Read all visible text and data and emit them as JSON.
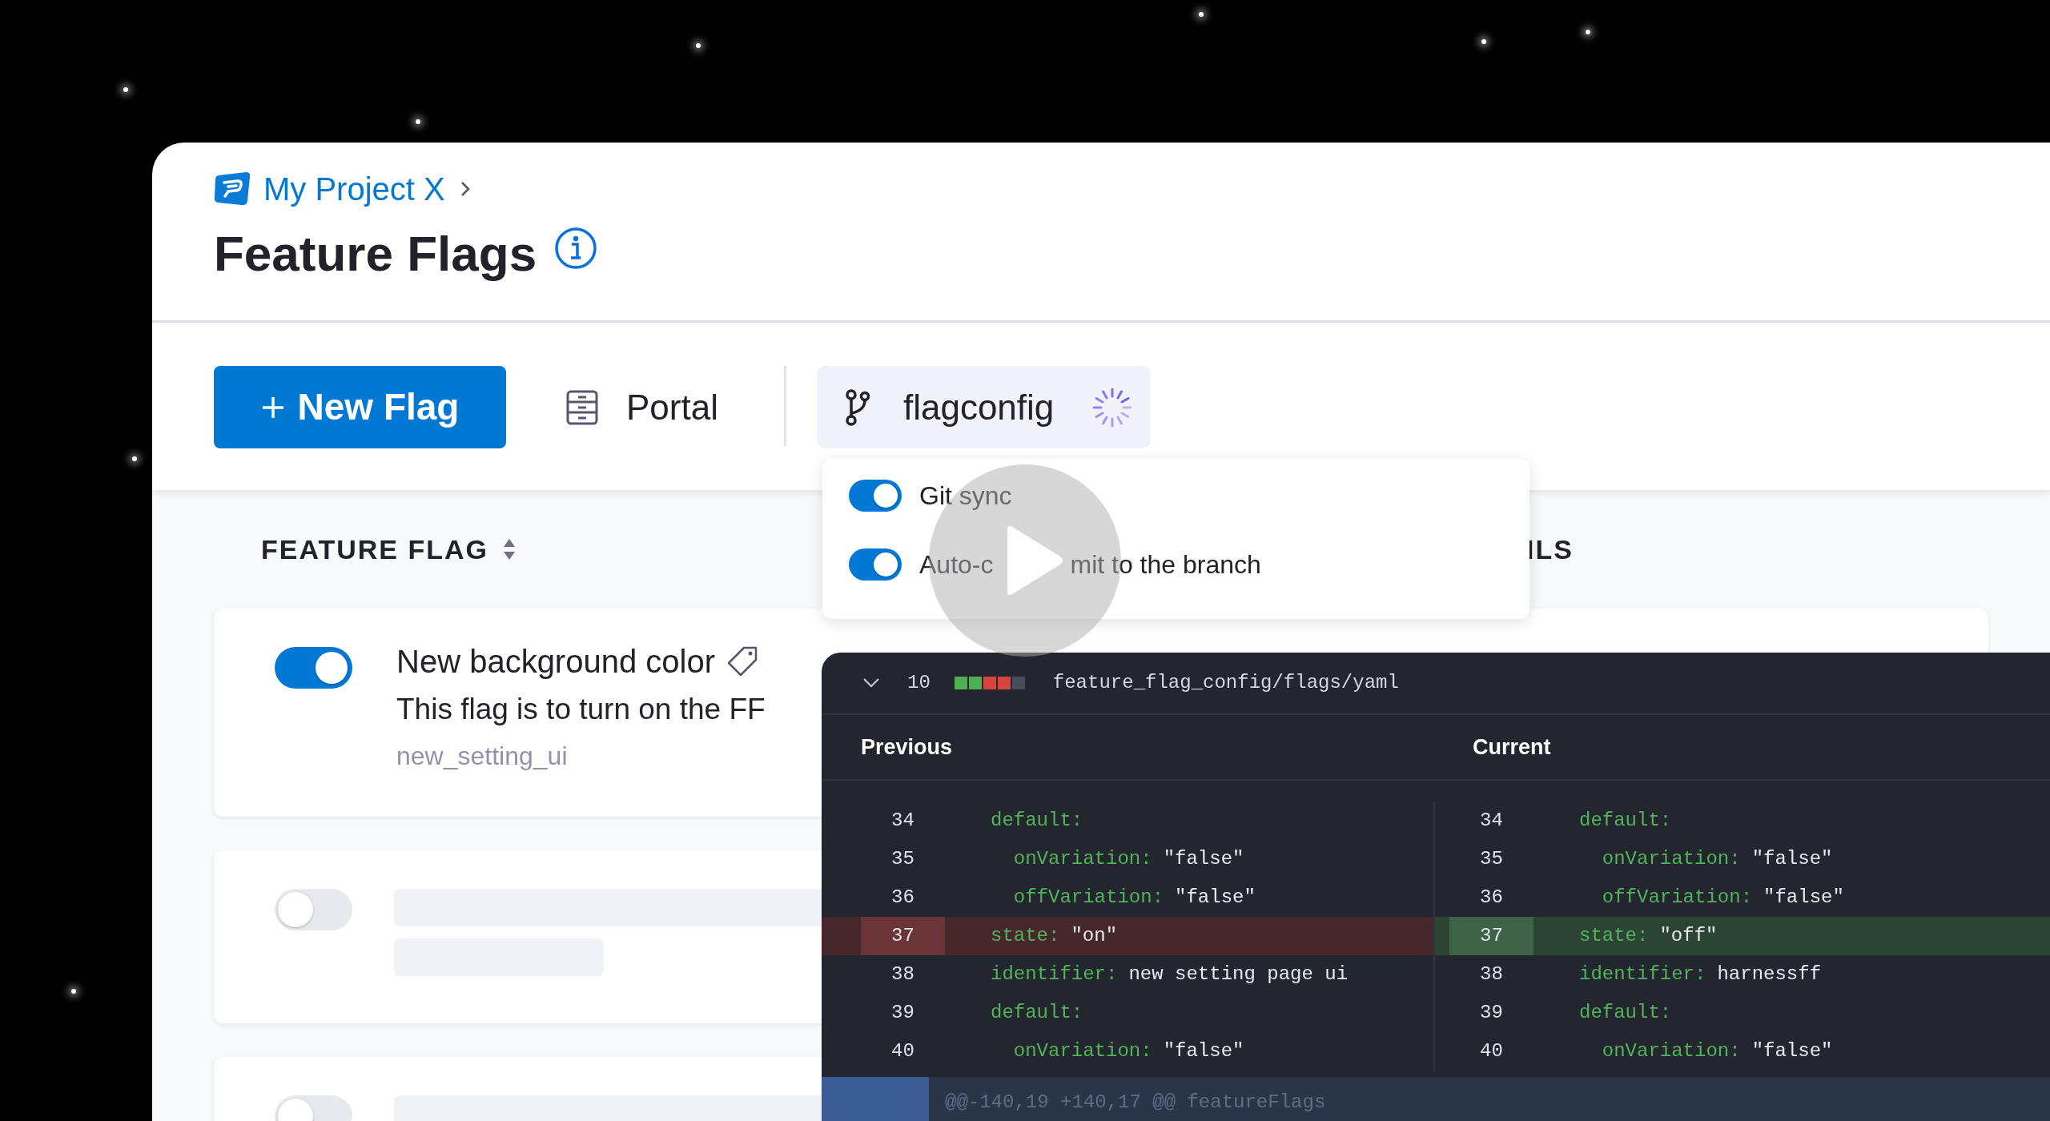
{
  "breadcrumb": {
    "project": "My Project X"
  },
  "page_title": "Feature Flags",
  "toolbar": {
    "new_button": "New Flag",
    "portal": "Portal",
    "branch": {
      "name": "flagconfig",
      "loading": true
    }
  },
  "branch_menu": {
    "options": [
      {
        "label": "Git sync",
        "on": true
      },
      {
        "label_parts": [
          "Auto-c",
          "mit to the branch"
        ],
        "on": true
      }
    ]
  },
  "table": {
    "columns": [
      {
        "label": "FEATURE FLAG",
        "sortable": true
      },
      {
        "label": "ILS",
        "sortable": false
      }
    ],
    "rows": [
      {
        "kind": "flag",
        "on": true,
        "name": "New background color",
        "description": "This flag is to turn on the FF",
        "identifier": "new_setting_ui"
      },
      {
        "kind": "skeleton",
        "on": false
      },
      {
        "kind": "skeleton",
        "on": false
      }
    ]
  },
  "diff": {
    "expanded": true,
    "changes": "10",
    "stat_blocks": [
      {
        "color": "#4caf50"
      },
      {
        "color": "#4caf50"
      },
      {
        "color": "#d9453d"
      },
      {
        "color": "#d9453d"
      },
      {
        "color": "#4a4e58"
      }
    ],
    "file": "feature_flag_config/flags/yaml",
    "panes": [
      {
        "title": "Previous",
        "lines": [
          {
            "number": "34",
            "kind": "context",
            "key": "default:"
          },
          {
            "number": "35",
            "kind": "context",
            "key": "  onVariation:",
            "value": "\"false\""
          },
          {
            "number": "36",
            "kind": "context",
            "key": "  offVariation:",
            "value": "\"false\""
          },
          {
            "number": "37",
            "kind": "removed",
            "key": "state:",
            "value": "\"on\""
          },
          {
            "number": "38",
            "kind": "context",
            "key": "identifier:",
            "value": "new setting page ui"
          },
          {
            "number": "39",
            "kind": "context",
            "key": "default:"
          },
          {
            "number": "40",
            "kind": "context",
            "key": "  onVariation:",
            "value": "\"false\""
          }
        ]
      },
      {
        "title": "Current",
        "lines": [
          {
            "number": "34",
            "kind": "context",
            "key": "default:"
          },
          {
            "number": "35",
            "kind": "context",
            "key": "  onVariation:",
            "value": "\"false\""
          },
          {
            "number": "36",
            "kind": "context",
            "key": "  offVariation:",
            "value": "\"false\""
          },
          {
            "number": "37",
            "kind": "added",
            "key": "state:",
            "value": "\"off\""
          },
          {
            "number": "38",
            "kind": "context",
            "key": "identifier:",
            "value": "harnessff"
          },
          {
            "number": "39",
            "kind": "context",
            "key": "default:"
          },
          {
            "number": "40",
            "kind": "context",
            "key": "  onVariation:",
            "value": "\"false\""
          }
        ]
      }
    ],
    "hunk": "@@-140,19 +140,17 @@ featureFlags"
  }
}
